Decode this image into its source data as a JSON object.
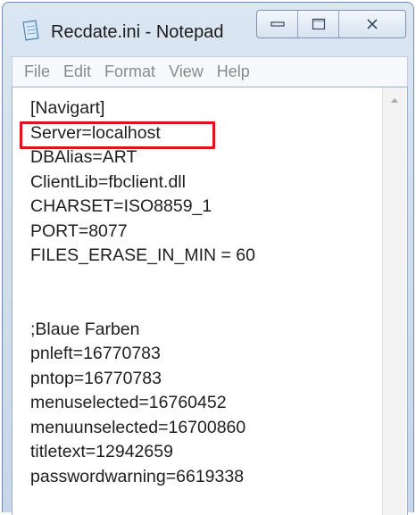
{
  "window": {
    "title": "Recdate.ini - Notepad",
    "caption_buttons": [
      "minimize-icon",
      "maximize-icon",
      "close-icon"
    ]
  },
  "menu": [
    "File",
    "Edit",
    "Format",
    "View",
    "Help"
  ],
  "content": {
    "lines": [
      "[Navigart]",
      "Server=localhost",
      "DBAlias=ART",
      "ClientLib=fbclient.dll",
      "CHARSET=ISO8859_1",
      "PORT=8077",
      "FILES_ERASE_IN_MIN = 60",
      "",
      "",
      ";Blaue Farben",
      "pnleft=16770783",
      "pntop=16770783",
      "menuselected=16760452",
      "menuunselected=16700860",
      "titletext=12942659",
      "passwordwarning=6619338"
    ],
    "highlighted_line": "Server=localhost",
    "highlight_color": "#e0131c"
  }
}
